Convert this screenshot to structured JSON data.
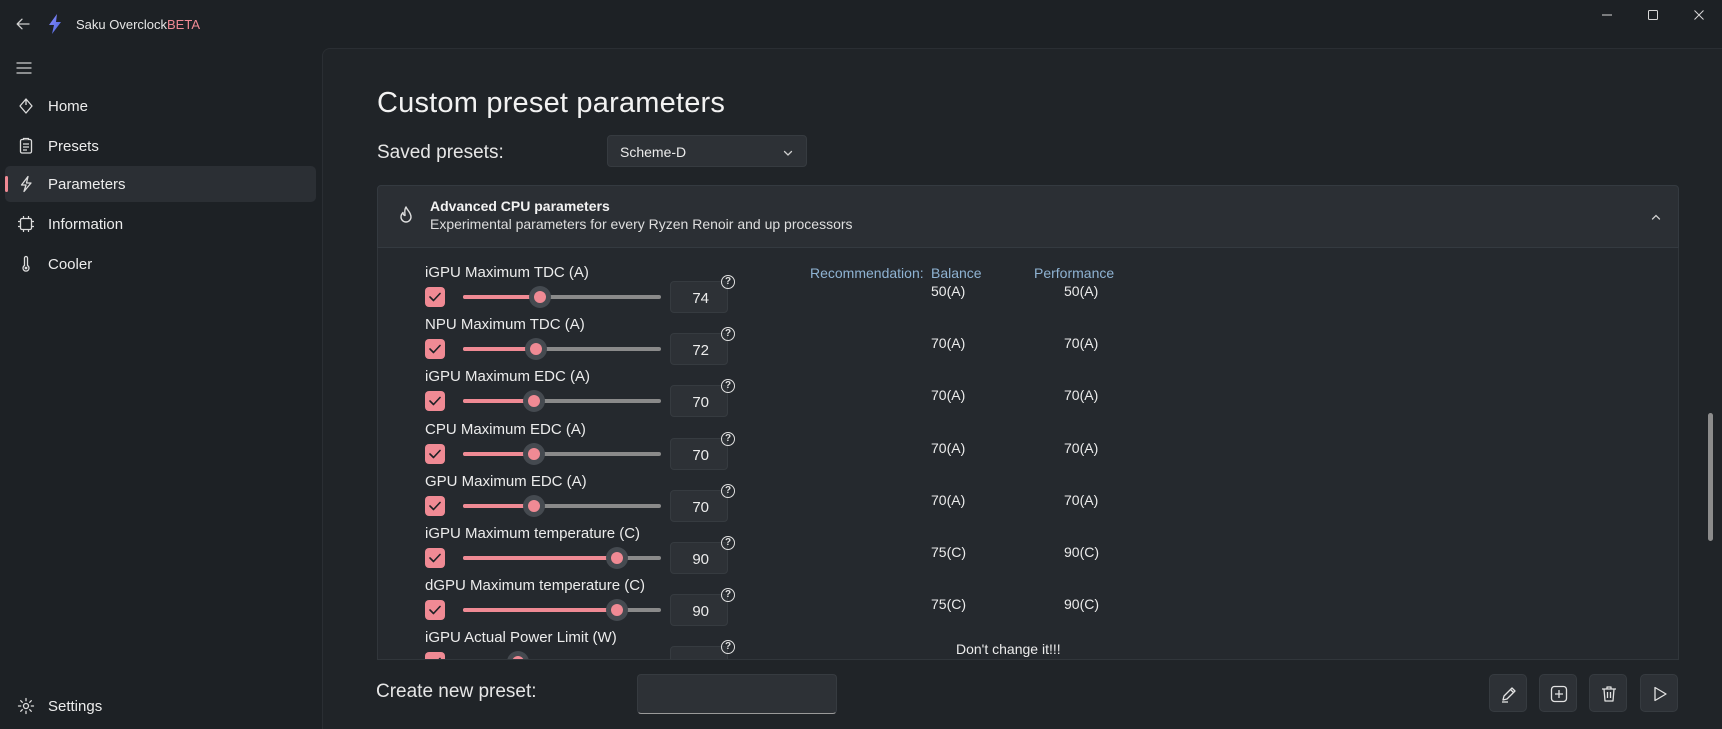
{
  "app": {
    "title": "Saku Overclock",
    "badge": "BETA"
  },
  "sidebar": {
    "items": [
      {
        "label": "Home",
        "icon": "home-icon"
      },
      {
        "label": "Presets",
        "icon": "presets-icon"
      },
      {
        "label": "Parameters",
        "icon": "lightning-icon",
        "active": true
      },
      {
        "label": "Information",
        "icon": "chip-icon"
      },
      {
        "label": "Cooler",
        "icon": "thermometer-icon"
      }
    ],
    "settings_label": "Settings"
  },
  "main": {
    "title": "Custom preset parameters",
    "saved_presets_label": "Saved presets:",
    "selected_preset": "Scheme-D",
    "expander": {
      "title": "Advanced CPU parameters",
      "description": "Experimental parameters for every Ryzen Renoir and up processors"
    },
    "recommendation": {
      "label": "Recommendation:",
      "balance_label": "Balance",
      "performance_label": "Performance"
    },
    "params": [
      {
        "label": "iGPU Maximum TDC (A)",
        "value": "74",
        "fill_fraction": 0.39,
        "checked": true,
        "balance": "50(A)",
        "performance": "50(A)"
      },
      {
        "label": "NPU Maximum TDC (A)",
        "value": "72",
        "fill_fraction": 0.37,
        "checked": true,
        "balance": "70(A)",
        "performance": "70(A)"
      },
      {
        "label": "iGPU Maximum EDC (A)",
        "value": "70",
        "fill_fraction": 0.36,
        "checked": true,
        "balance": "70(A)",
        "performance": "70(A)"
      },
      {
        "label": "CPU Maximum EDC (A)",
        "value": "70",
        "fill_fraction": 0.36,
        "checked": true,
        "balance": "70(A)",
        "performance": "70(A)"
      },
      {
        "label": "GPU Maximum EDC (A)",
        "value": "70",
        "fill_fraction": 0.36,
        "checked": true,
        "balance": "70(A)",
        "performance": "70(A)"
      },
      {
        "label": "iGPU Maximum temperature (C)",
        "value": "90",
        "fill_fraction": 0.78,
        "checked": true,
        "balance": "75(C)",
        "performance": "90(C)"
      },
      {
        "label": "dGPU Maximum temperature (C)",
        "value": "90",
        "fill_fraction": 0.78,
        "checked": true,
        "balance": "75(C)",
        "performance": "90(C)"
      },
      {
        "label": "iGPU Actual Power Limit (W)",
        "value": "",
        "fill_fraction": 0.28,
        "checked": true,
        "note": "Don't change it!!!"
      }
    ]
  },
  "bottom": {
    "create_label": "Create new preset:",
    "create_input_value": ""
  },
  "colors": {
    "accent": "#f08a94",
    "recommendation_header": "#8fb3d3"
  }
}
